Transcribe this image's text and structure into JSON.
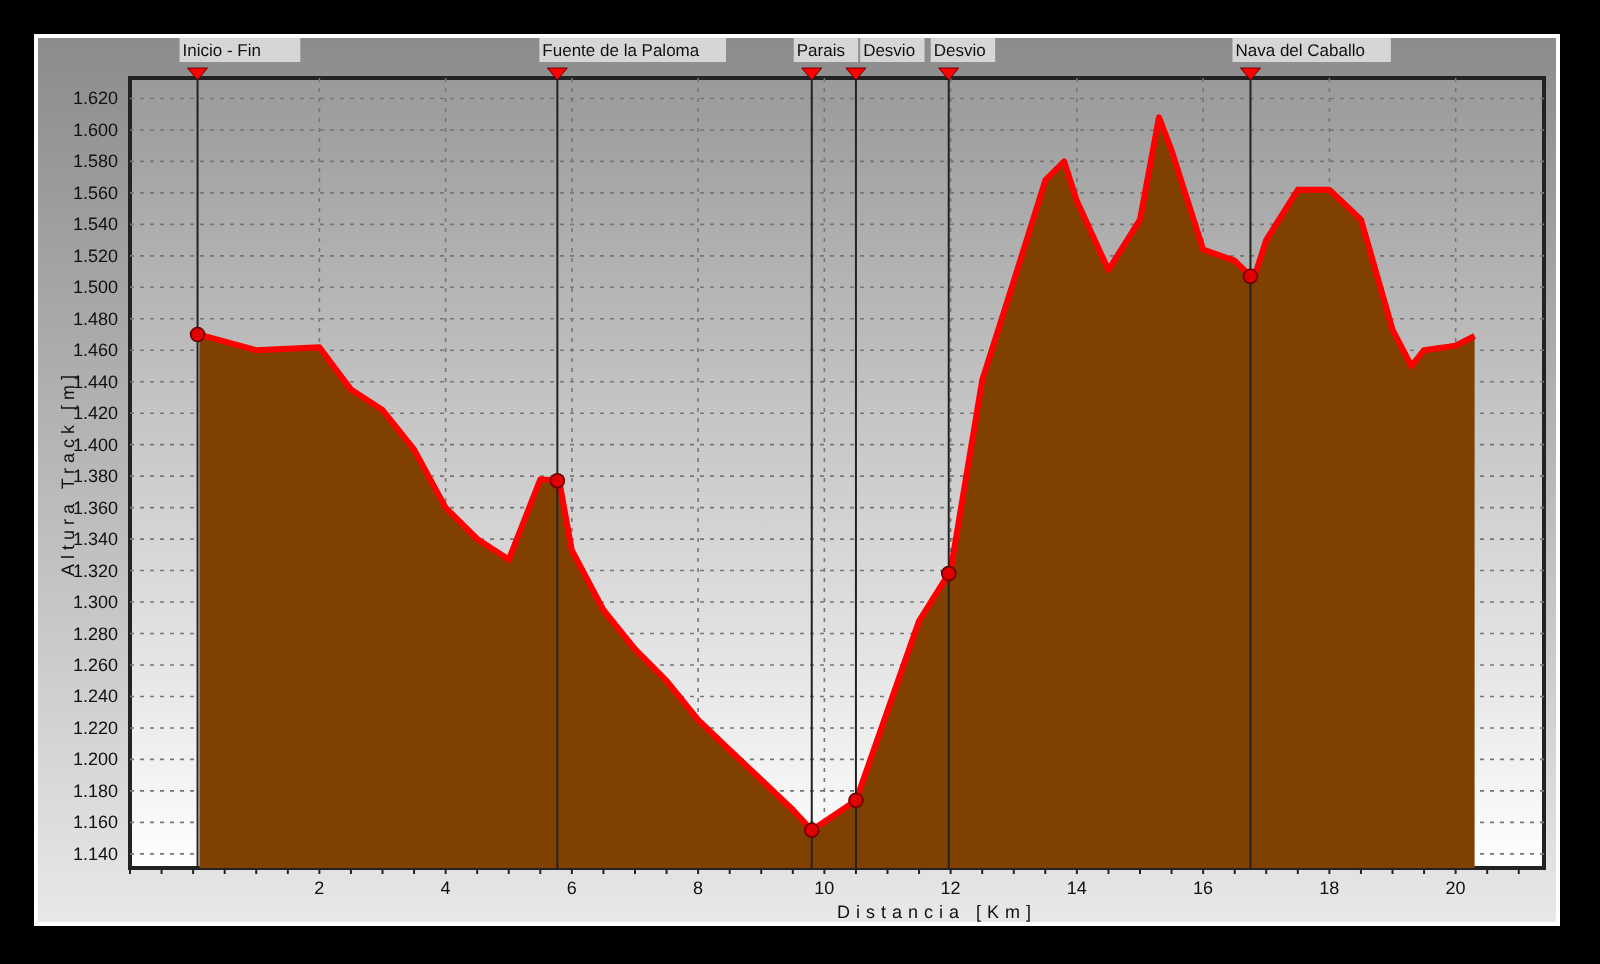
{
  "profile": {
    "chart_data": {
      "type": "area",
      "xlabel": "Distancia [Km]",
      "ylabel": "Altura Track [m]",
      "x": [
        0.1,
        1,
        2,
        2.5,
        3,
        3.5,
        4,
        4.5,
        5,
        5.5,
        5.8,
        6,
        6.5,
        7,
        7.5,
        8,
        8.5,
        9,
        9.5,
        9.8,
        10.5,
        11,
        11.5,
        12,
        12.5,
        13,
        13.5,
        13.8,
        14,
        14.5,
        15,
        15.3,
        15.5,
        16,
        16.5,
        16.8,
        17,
        17.5,
        18,
        18.5,
        19,
        19.3,
        19.5,
        20,
        20.3
      ],
      "grid": true,
      "series": [
        {
          "color": "#7f4000",
          "values": [
            1470,
            1460,
            1462,
            1435,
            1422,
            1397,
            1360,
            1340,
            1327,
            1378,
            1377,
            1333,
            1295,
            1270,
            1250,
            1225,
            1206,
            1187,
            1168,
            1155,
            1174,
            1231,
            1288,
            1320,
            1441,
            1504,
            1568,
            1580,
            1555,
            1511,
            1543,
            1608,
            1587,
            1524,
            1517,
            1505,
            1530,
            1562,
            1562,
            1543,
            1473,
            1450,
            1460,
            1463,
            1469
          ]
        }
      ],
      "xlim": [
        -1,
        21.4
      ],
      "ylim": [
        1131,
        1633
      ],
      "xticks": [
        2,
        4,
        6,
        8,
        10,
        12,
        14,
        16,
        18,
        20
      ],
      "yticks": [
        {
          "value": 1140,
          "label": "1.140"
        },
        {
          "value": 1160,
          "label": "1.160"
        },
        {
          "value": 1180,
          "label": "1.180"
        },
        {
          "value": 1200,
          "label": "1.200"
        },
        {
          "value": 1220,
          "label": "1.220"
        },
        {
          "value": 1240,
          "label": "1.240"
        },
        {
          "value": 1260,
          "label": "1.260"
        },
        {
          "value": 1280,
          "label": "1.280"
        },
        {
          "value": 1300,
          "label": "1.300"
        },
        {
          "value": 1320,
          "label": "1.320"
        },
        {
          "value": 1340,
          "label": "1.340"
        },
        {
          "value": 1360,
          "label": "1.360"
        },
        {
          "value": 1380,
          "label": "1.380"
        },
        {
          "value": 1400,
          "label": "1.400"
        },
        {
          "value": 1420,
          "label": "1.420"
        },
        {
          "value": 1440,
          "label": "1.440"
        },
        {
          "value": 1460,
          "label": "1.460"
        },
        {
          "value": 1480,
          "label": "1.480"
        },
        {
          "value": 1500,
          "label": "1.500"
        },
        {
          "value": 1520,
          "label": "1.520"
        },
        {
          "value": 1540,
          "label": "1.540"
        },
        {
          "value": 1560,
          "label": "1.560"
        },
        {
          "value": 1580,
          "label": "1.580"
        },
        {
          "value": 1600,
          "label": "1.600"
        },
        {
          "value": 1620,
          "label": "1.620"
        }
      ],
      "ref_lines": [
        {
          "axis": "x",
          "value": 0.07,
          "label": "Inicio - Fin"
        },
        {
          "axis": "x",
          "value": 5.77,
          "label": "Fuente de la Paloma"
        },
        {
          "axis": "x",
          "value": 9.8,
          "label": "Parais"
        },
        {
          "axis": "x",
          "value": 10.5,
          "label": "Desvio"
        },
        {
          "axis": "x",
          "value": 11.97,
          "label": "Desvio"
        },
        {
          "axis": "x",
          "value": 16.75,
          "label": "Nava del Caballo"
        }
      ]
    }
  }
}
